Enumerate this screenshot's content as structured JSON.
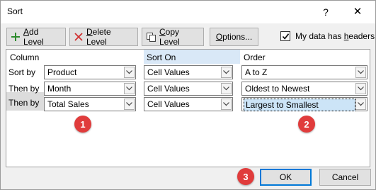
{
  "window": {
    "title": "Sort",
    "help": "?",
    "close": "✕"
  },
  "toolbar": {
    "add_level": {
      "accel": "A",
      "rest": "dd Level"
    },
    "delete_level": {
      "accel": "D",
      "rest": "elete Level"
    },
    "copy_level": {
      "accel": "C",
      "rest": "opy Level"
    },
    "options": {
      "accel": "O",
      "rest": "ptions..."
    },
    "headers": {
      "prefix": "My data has ",
      "accel": "h",
      "rest": "eaders",
      "checked": true
    }
  },
  "grid": {
    "headers": {
      "column": "Column",
      "sort_on": "Sort On",
      "order": "Order"
    },
    "rows": [
      {
        "label": "Sort by",
        "column": "Product",
        "sort_on": "Cell Values",
        "order": "A to Z"
      },
      {
        "label": "Then by",
        "column": "Month",
        "sort_on": "Cell Values",
        "order": "Oldest to Newest"
      },
      {
        "label": "Then by",
        "column": "Total Sales",
        "sort_on": "Cell Values",
        "order": "Largest to Smallest"
      }
    ]
  },
  "badges": [
    "1",
    "2",
    "3"
  ],
  "buttons": {
    "ok": "OK",
    "cancel": "Cancel"
  },
  "colors": {
    "badge": "#e03c3c",
    "ok_border": "#0078d7",
    "selection": "#cce4f7",
    "header_highlight": "#d9e8f7"
  }
}
